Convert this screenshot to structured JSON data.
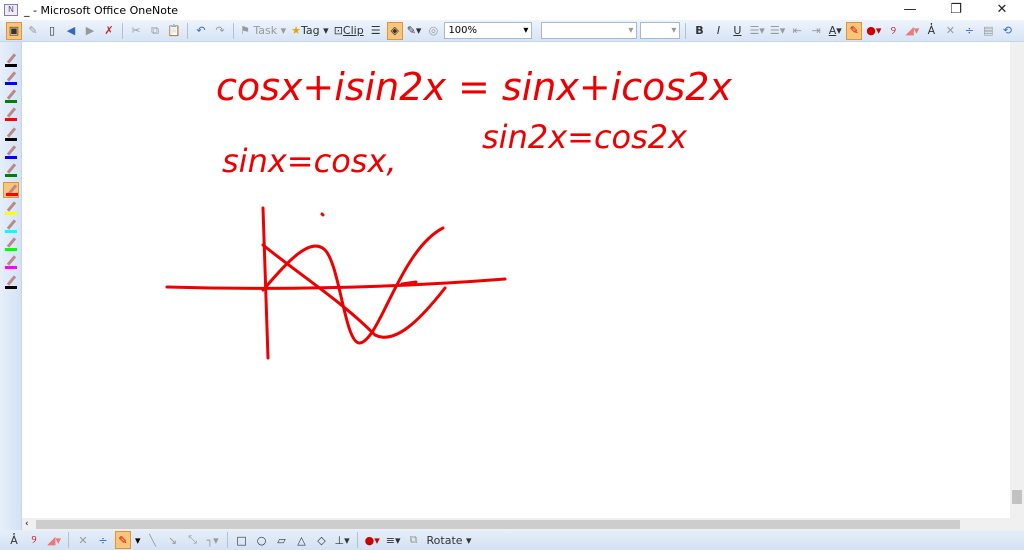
{
  "window": {
    "title": "_ - Microsoft Office OneNote",
    "minimize": "—",
    "restore": "❐",
    "close": "✕"
  },
  "toolbar": {
    "task": "Task",
    "tag": "Tag",
    "clip": "Clip",
    "zoom": "100%",
    "font": "",
    "size": "",
    "bold": "B",
    "italic": "I",
    "underline": "U",
    "text_format": "A",
    "type_text": "A̔"
  },
  "pens": [
    {
      "color": "#000000"
    },
    {
      "color": "#0000ff"
    },
    {
      "color": "#008000"
    },
    {
      "color": "#ff0000"
    },
    {
      "color": "#000000"
    },
    {
      "color": "#0000ff"
    },
    {
      "color": "#008000"
    },
    {
      "color": "#ff0000",
      "selected": true
    },
    {
      "color": "#ffff00"
    },
    {
      "color": "#00ffff"
    },
    {
      "color": "#00ff00"
    },
    {
      "color": "#ff00ff"
    },
    {
      "color": "#000000"
    }
  ],
  "ink": {
    "color": "#ee0000",
    "line1": "cosx+isin2x = sinx+icos2x",
    "line2a": "sinx=cosx,",
    "line2b": "sin2x=cos2x"
  },
  "bottombar": {
    "rotate": "Rotate",
    "type_text": "A̔"
  }
}
